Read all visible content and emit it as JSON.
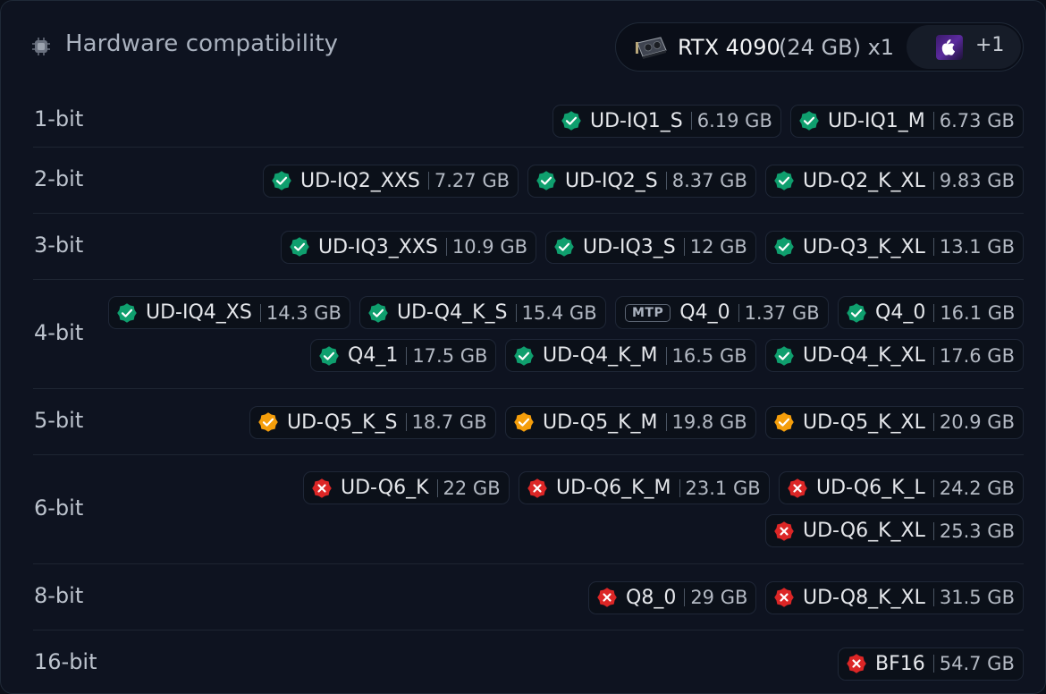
{
  "header": {
    "title": "Hardware compatibility",
    "title_icon": "chip-icon",
    "gpu": {
      "name": "RTX 4090",
      "memory": "(24 GB) x1",
      "icon": "gpu-card-icon"
    },
    "apple": {
      "icon": "apple-icon",
      "count": "+1"
    }
  },
  "colors": {
    "ok": "#0f9f6e",
    "warn": "#f59e0b",
    "fail": "#dc2626"
  },
  "rows": [
    {
      "label": "1-bit",
      "quants": [
        {
          "name": "UD-IQ1_S",
          "size": "6.19 GB",
          "status": "ok"
        },
        {
          "name": "UD-IQ1_M",
          "size": "6.73 GB",
          "status": "ok"
        }
      ]
    },
    {
      "label": "2-bit",
      "quants": [
        {
          "name": "UD-IQ2_XXS",
          "size": "7.27 GB",
          "status": "ok"
        },
        {
          "name": "UD-IQ2_S",
          "size": "8.37 GB",
          "status": "ok"
        },
        {
          "name": "UD-Q2_K_XL",
          "size": "9.83 GB",
          "status": "ok"
        }
      ]
    },
    {
      "label": "3-bit",
      "quants": [
        {
          "name": "UD-IQ3_XXS",
          "size": "10.9 GB",
          "status": "ok"
        },
        {
          "name": "UD-IQ3_S",
          "size": "12 GB",
          "status": "ok"
        },
        {
          "name": "UD-Q3_K_XL",
          "size": "13.1 GB",
          "status": "ok"
        }
      ]
    },
    {
      "label": "4-bit",
      "quants": [
        {
          "name": "UD-IQ4_XS",
          "size": "14.3 GB",
          "status": "ok"
        },
        {
          "name": "UD-Q4_K_S",
          "size": "15.4 GB",
          "status": "ok"
        },
        {
          "name": "Q4_0",
          "size": "1.37 GB",
          "status": "mtp",
          "tag": "MTP"
        },
        {
          "name": "Q4_0",
          "size": "16.1 GB",
          "status": "ok"
        },
        {
          "name": "Q4_1",
          "size": "17.5 GB",
          "status": "ok"
        },
        {
          "name": "UD-Q4_K_M",
          "size": "16.5 GB",
          "status": "ok"
        },
        {
          "name": "UD-Q4_K_XL",
          "size": "17.6 GB",
          "status": "ok"
        }
      ]
    },
    {
      "label": "5-bit",
      "quants": [
        {
          "name": "UD-Q5_K_S",
          "size": "18.7 GB",
          "status": "warn"
        },
        {
          "name": "UD-Q5_K_M",
          "size": "19.8 GB",
          "status": "warn"
        },
        {
          "name": "UD-Q5_K_XL",
          "size": "20.9 GB",
          "status": "warn"
        }
      ]
    },
    {
      "label": "6-bit",
      "quants": [
        {
          "name": "UD-Q6_K",
          "size": "22 GB",
          "status": "fail"
        },
        {
          "name": "UD-Q6_K_M",
          "size": "23.1 GB",
          "status": "fail"
        },
        {
          "name": "UD-Q6_K_L",
          "size": "24.2 GB",
          "status": "fail"
        },
        {
          "name": "UD-Q6_K_XL",
          "size": "25.3 GB",
          "status": "fail"
        }
      ]
    },
    {
      "label": "8-bit",
      "quants": [
        {
          "name": "Q8_0",
          "size": "29 GB",
          "status": "fail"
        },
        {
          "name": "UD-Q8_K_XL",
          "size": "31.5 GB",
          "status": "fail"
        }
      ]
    },
    {
      "label": "16-bit",
      "quants": [
        {
          "name": "BF16",
          "size": "54.7 GB",
          "status": "fail"
        }
      ]
    }
  ]
}
